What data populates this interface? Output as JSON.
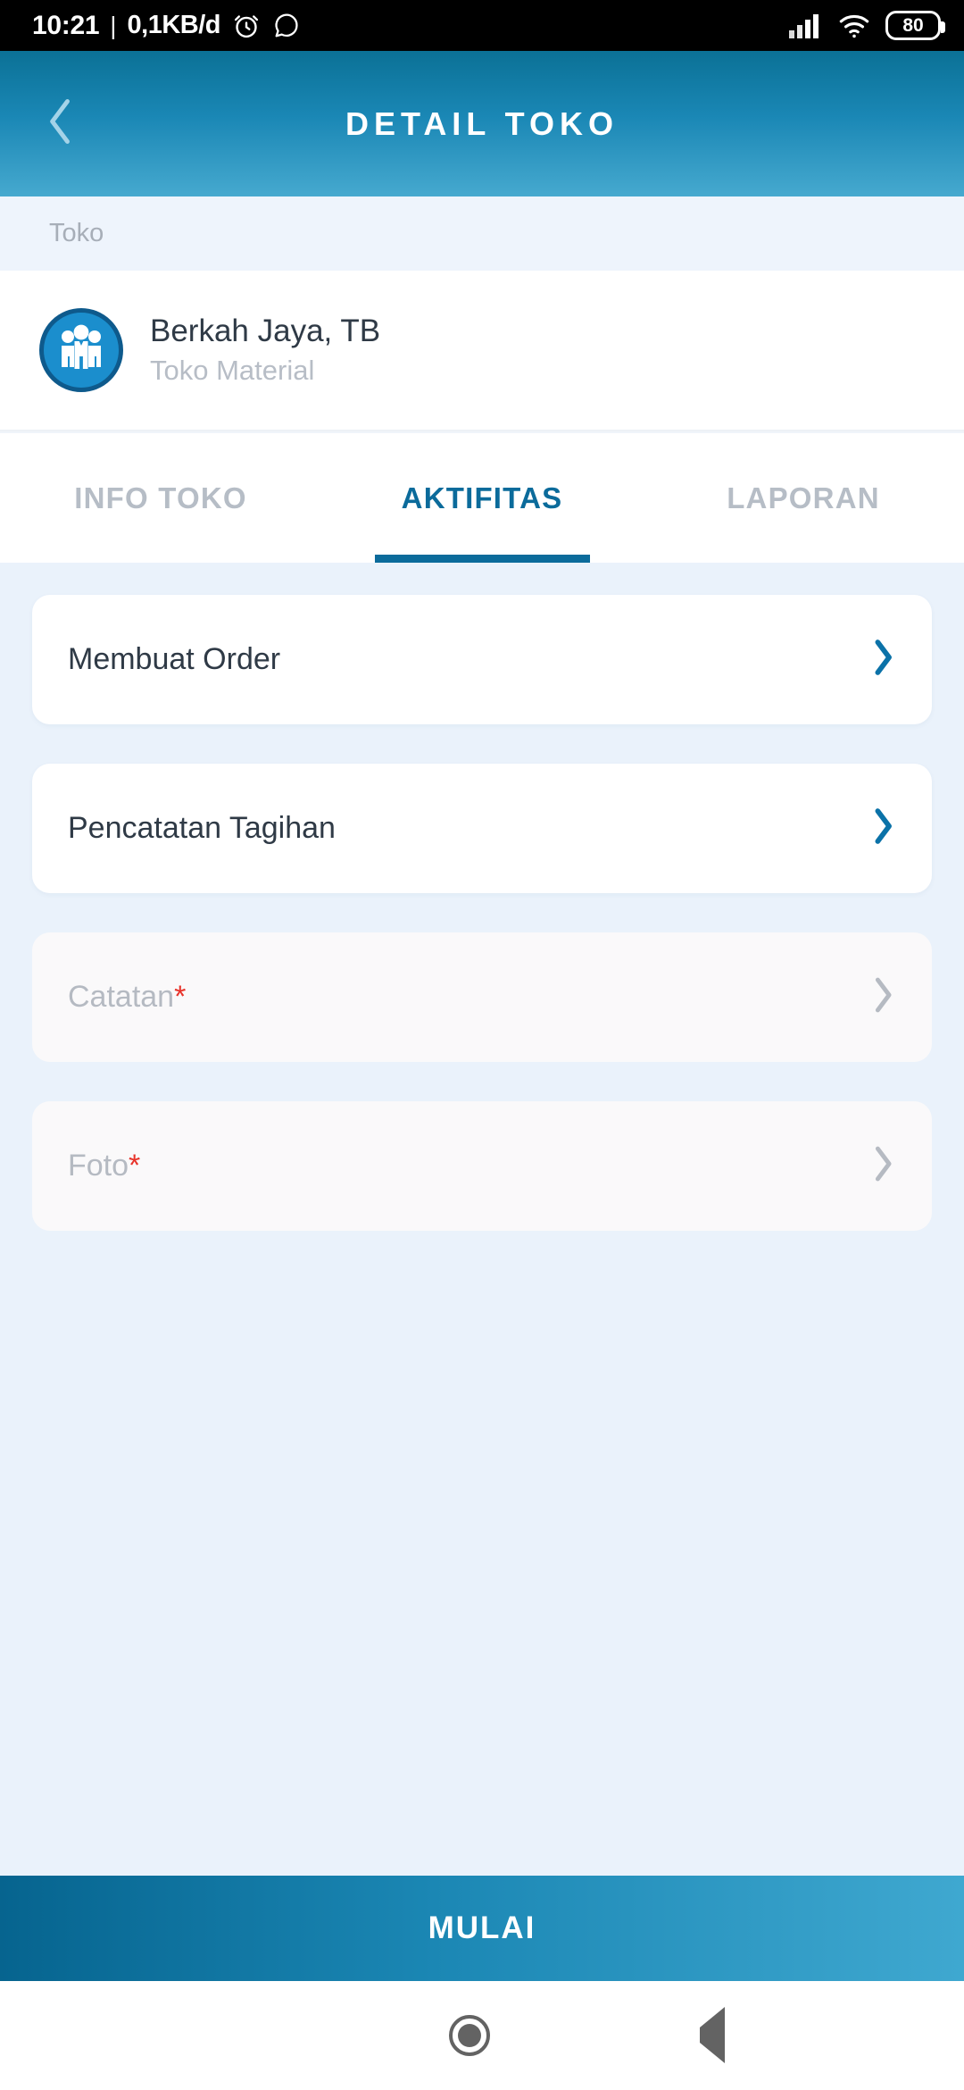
{
  "statusbar": {
    "time": "10:21",
    "separator": "|",
    "data_rate": "0,1KB/d",
    "alarm_icon": "alarm-clock-icon",
    "whatsapp_icon": "whatsapp-icon",
    "signal_icon": "cellular-signal-icon",
    "wifi_icon": "wifi-icon",
    "battery_level": "80"
  },
  "appbar": {
    "back_icon": "back-chevron-icon",
    "title": "DETAIL TOKO"
  },
  "section": {
    "label": "Toko"
  },
  "store": {
    "avatar_icon": "group-people-icon",
    "name": "Berkah Jaya, TB",
    "type": "Toko Material"
  },
  "tabs": [
    {
      "label": "INFO TOKO",
      "active": false
    },
    {
      "label": "AKTIFITAS",
      "active": true
    },
    {
      "label": "LAPORAN",
      "active": false
    }
  ],
  "activities": [
    {
      "label": "Membuat Order",
      "required": "",
      "enabled": true,
      "chevron_icon": "chevron-right-icon"
    },
    {
      "label": "Pencatatan Tagihan",
      "required": "",
      "enabled": true,
      "chevron_icon": "chevron-right-icon"
    },
    {
      "label": "Catatan",
      "required": "*",
      "enabled": false,
      "chevron_icon": "chevron-right-icon"
    },
    {
      "label": "Foto",
      "required": "*",
      "enabled": false,
      "chevron_icon": "chevron-right-icon"
    }
  ],
  "cta": {
    "label": "MULAI"
  },
  "navbar": {
    "recents_icon": "recents-square-icon",
    "home_icon": "home-circle-icon",
    "back_icon": "back-triangle-icon"
  },
  "colors": {
    "brand_dark": "#0b6b9b",
    "brand_light": "#3fa8d0",
    "accent_chevron": "#0b72a8",
    "required_red": "#e8332a",
    "content_bg": "#eaf2fb",
    "disabled_text": "#b5bac2"
  }
}
